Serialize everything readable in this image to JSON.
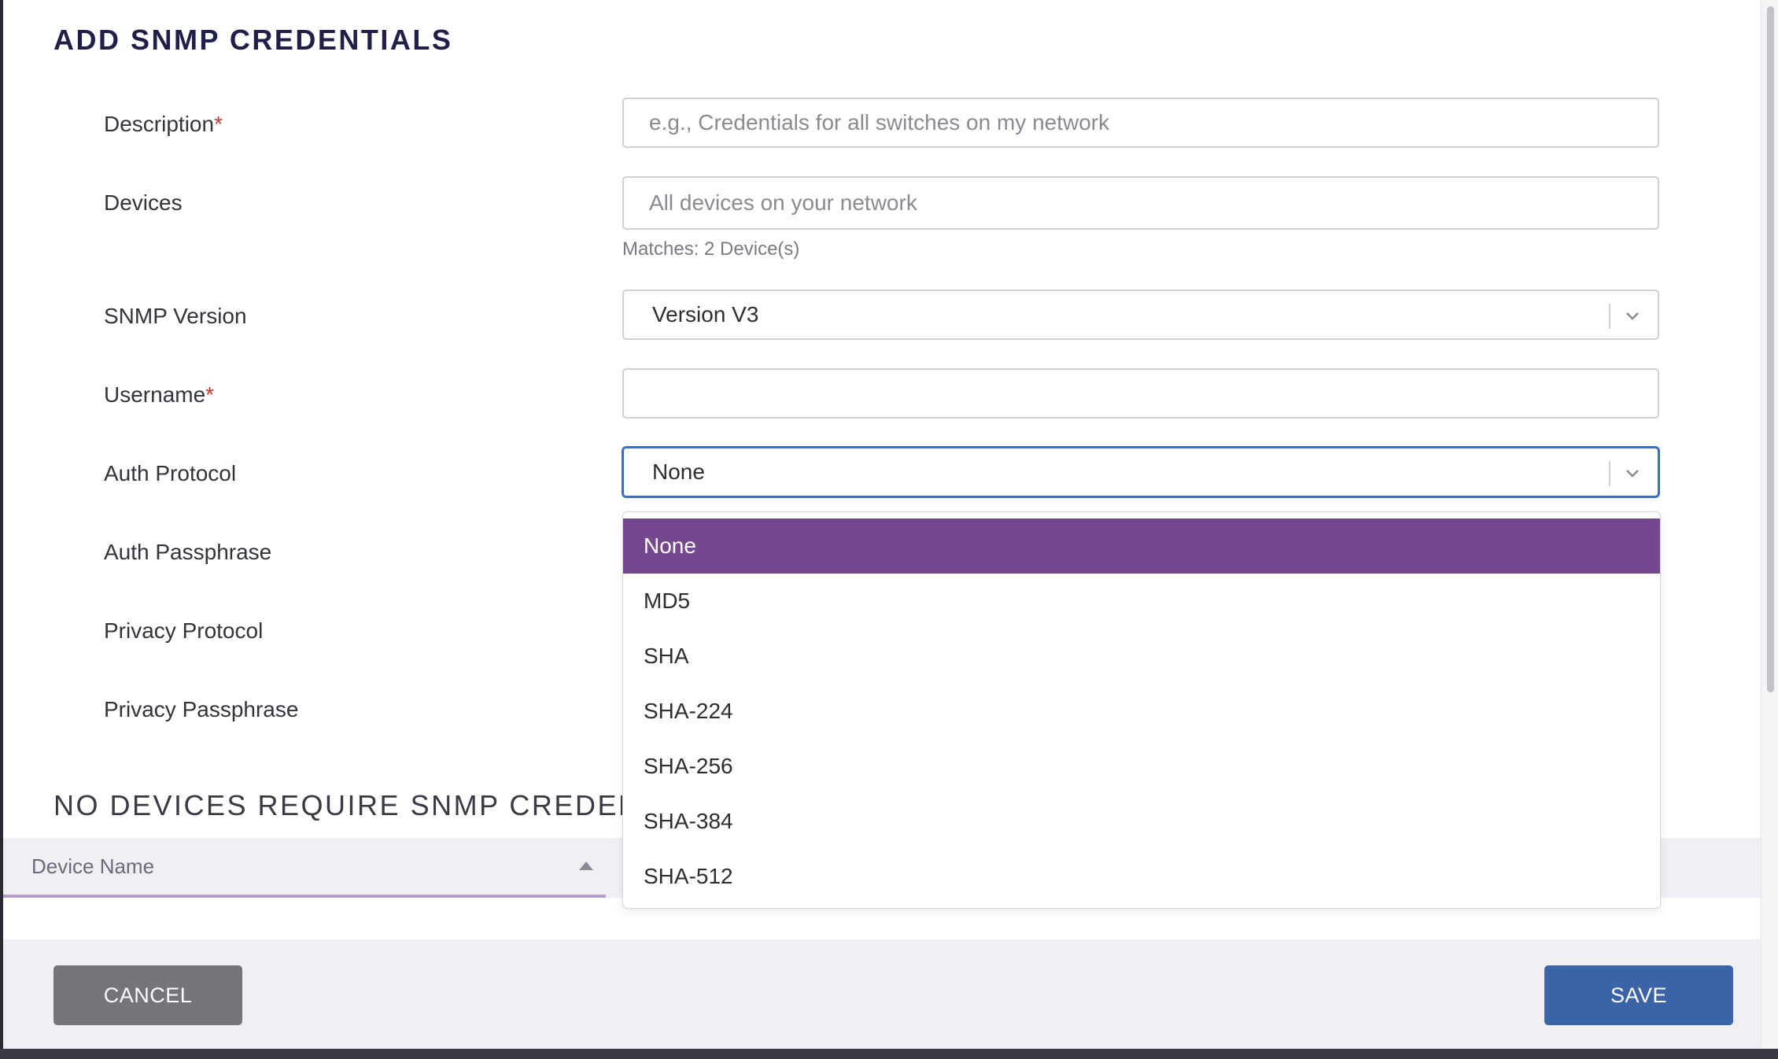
{
  "dialog": {
    "title": "ADD SNMP CREDENTIALS"
  },
  "form": {
    "description": {
      "label": "Description",
      "required_mark": "*",
      "placeholder": "e.g., Credentials for all switches on my network",
      "value": ""
    },
    "devices": {
      "label": "Devices",
      "placeholder": "All devices on your network",
      "value": "",
      "hint": "Matches: 2 Device(s)"
    },
    "snmp_version": {
      "label": "SNMP Version",
      "value": "Version V3"
    },
    "username": {
      "label": "Username",
      "required_mark": "*",
      "value": ""
    },
    "auth_protocol": {
      "label": "Auth Protocol",
      "value": "None",
      "options": [
        "None",
        "MD5",
        "SHA",
        "SHA-224",
        "SHA-256",
        "SHA-384",
        "SHA-512"
      ],
      "selected_index": 0
    },
    "auth_passphrase": {
      "label": "Auth Passphrase"
    },
    "privacy_protocol": {
      "label": "Privacy Protocol"
    },
    "privacy_passphrase": {
      "label": "Privacy Passphrase"
    }
  },
  "devices_section": {
    "title": "NO DEVICES REQUIRE SNMP CREDENTIALS",
    "columns": [
      "Device Name"
    ],
    "sort": "ascending"
  },
  "footer": {
    "cancel_label": "CANCEL",
    "save_label": "SAVE"
  },
  "colors": {
    "title": "#1f1f4a",
    "required": "#c0392b",
    "focus_border": "#3b6fc4",
    "option_selected": "#75478f",
    "save_button": "#3b63a8",
    "cancel_button": "#747479",
    "footer_bg": "#eef0f5"
  },
  "icons": {
    "select_toggle": "chevron-down-icon",
    "sort": "sort-ascending-icon"
  }
}
